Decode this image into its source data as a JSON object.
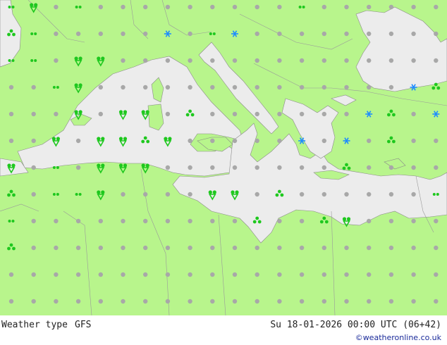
{
  "footer": {
    "product": "Weather type",
    "model": "GFS",
    "valid_time": "Su 18-01-2026 00:00 UTC (06+42)",
    "credit": "©weatheronline.co.uk"
  },
  "colors": {
    "land": "#b8f58c",
    "sea": "#ececec",
    "border": "#999999",
    "rain_green": "#1ec81e",
    "snow_blue": "#1e8cff",
    "dot_grey": "#a8a8a8"
  },
  "legend_symbols": [
    "grey-dot (dry)",
    "green drizzle/rain",
    "green shower",
    "blue snow"
  ]
}
